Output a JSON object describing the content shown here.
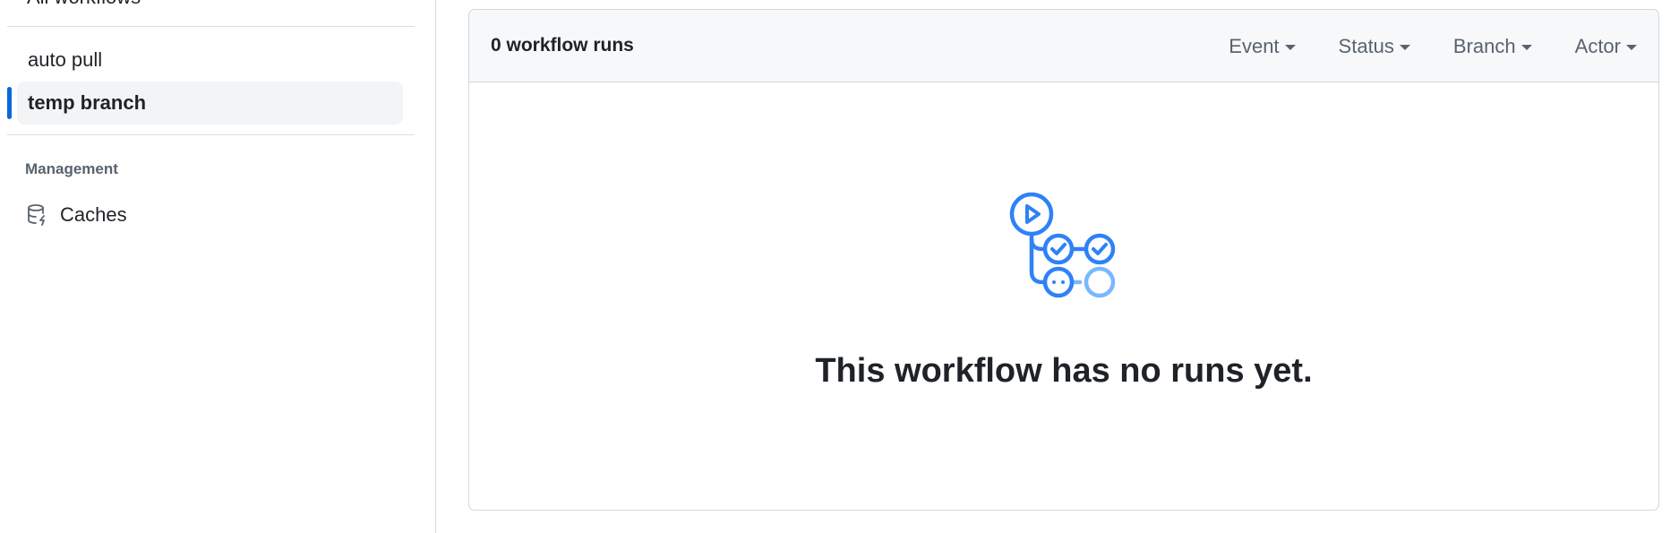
{
  "sidebar": {
    "truncated_item": "All workflows",
    "items": [
      {
        "label": "auto pull",
        "active": false
      },
      {
        "label": "temp branch",
        "active": true
      }
    ],
    "management_heading": "Management",
    "caches_label": "Caches",
    "caches_icon": "database-icon"
  },
  "main": {
    "run_count": "0 workflow runs",
    "filters": [
      "Event",
      "Status",
      "Branch",
      "Actor"
    ],
    "empty_icon": "workflow-icon",
    "empty_message": "This workflow has no runs yet."
  },
  "colors": {
    "accent": "#0969da",
    "icon_blue": "#2f81f7",
    "icon_light_blue": "#79b8ff"
  }
}
